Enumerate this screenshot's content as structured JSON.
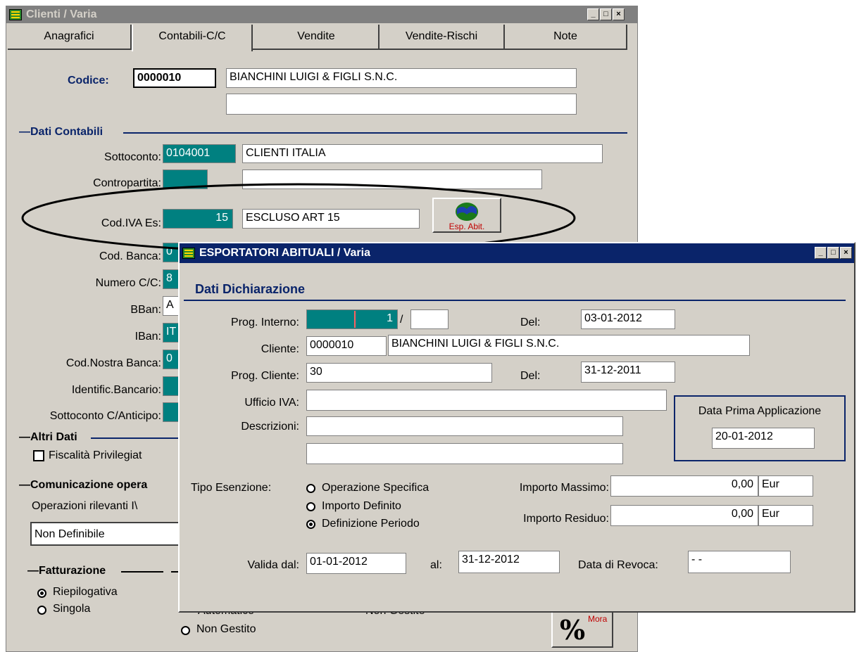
{
  "main_window": {
    "title": "Clienti / Varia",
    "tabs": [
      "Anagrafici",
      "Contabili-C/C",
      "Vendite",
      "Vendite-Rischi",
      "Note"
    ],
    "codice_label": "Codice:",
    "codice_value": "0000010",
    "ragione_sociale": "BIANCHINI LUIGI & FIGLI S.N.C.",
    "ragione_sociale_2": "",
    "dati_contabili": {
      "title": "Dati Contabili",
      "sottoconto_label": "Sottoconto:",
      "sottoconto_code": "0104001",
      "sottoconto_desc": "CLIENTI  ITALIA",
      "contropartita_label": "Contropartita:",
      "contropartita_code": "",
      "contropartita_desc": "",
      "cod_iva_label": "Cod.IVA Es:",
      "cod_iva_code": "15",
      "cod_iva_desc": "ESCLUSO ART 15",
      "esp_abit_button": "Esp. Abit.",
      "cod_banca_label": "Cod. Banca:",
      "cod_banca_value": "0",
      "numero_cc_label": "Numero C/C:",
      "numero_cc_value": "8",
      "bban_label": "BBan:",
      "bban_value": "A",
      "iban_label": "IBan:",
      "iban_value": "IT",
      "cod_nostra_banca_label": "Cod.Nostra Banca:",
      "cod_nostra_banca_value": "0",
      "identific_bancario_label": "Identific.Bancario:",
      "sottoconto_anticipo_label": "Sottoconto C/Anticipo:"
    },
    "altri_dati": {
      "title": "Altri Dati",
      "fiscalita_label": "Fiscalità Privilegiat"
    },
    "comunicazione": {
      "title": "Comunicazione opera",
      "operazioni_label": "Operazioni rilevanti I\\",
      "operazioni_value": "Non Definibile"
    },
    "fatturazione": {
      "title": "Fatturazione",
      "options": [
        "Riepilogativa",
        "Singola"
      ],
      "selected": "Riepilogativa"
    },
    "partial_radios": {
      "automatico": "Automatico",
      "non_gestito": "Non Gestito",
      "non_gestite": "Non Gestite"
    },
    "mora_button": "Mora"
  },
  "popup": {
    "title": "ESPORTATORI ABITUALI / Varia",
    "section_title": "Dati Dichiarazione",
    "prog_interno_label": "Prog. Interno:",
    "prog_interno_value": "1",
    "prog_interno_suffix": "",
    "del_label": "Del:",
    "del_value": "03-01-2012",
    "cliente_label": "Cliente:",
    "cliente_code": "0000010",
    "cliente_name": "BIANCHINI LUIGI & FIGLI S.N.C.",
    "prog_cliente_label": "Prog. Cliente:",
    "prog_cliente_value": "30",
    "del2_label": "Del:",
    "del2_value": "31-12-2011",
    "ufficio_iva_label": "Ufficio IVA:",
    "ufficio_iva_value": "",
    "descrizioni_label": "Descrizioni:",
    "descrizioni_1": "",
    "descrizioni_2": "",
    "data_prima_label": "Data Prima Applicazione",
    "data_prima_value": "20-01-2012",
    "tipo_esenzione_label": "Tipo Esenzione:",
    "tipo_options": [
      "Operazione Specifica",
      "Importo Definito",
      "Definizione Periodo"
    ],
    "tipo_selected": "Definizione Periodo",
    "importo_massimo_label": "Importo Massimo:",
    "importo_massimo_value": "0,00",
    "importo_residuo_label": "Importo Residuo:",
    "importo_residuo_value": "0,00",
    "currency": "Eur",
    "valida_dal_label": "Valida dal:",
    "valida_dal_value": "01-01-2012",
    "al_label": "al:",
    "al_value": "31-12-2012",
    "data_revoca_label": "Data di Revoca:",
    "data_revoca_value": "- -"
  },
  "colors": {
    "window_bg": "#d4d0c8",
    "active_title": "#0a246a",
    "inactive_title": "#808080",
    "teal_field": "#008080",
    "section_line": "#0a246a"
  }
}
